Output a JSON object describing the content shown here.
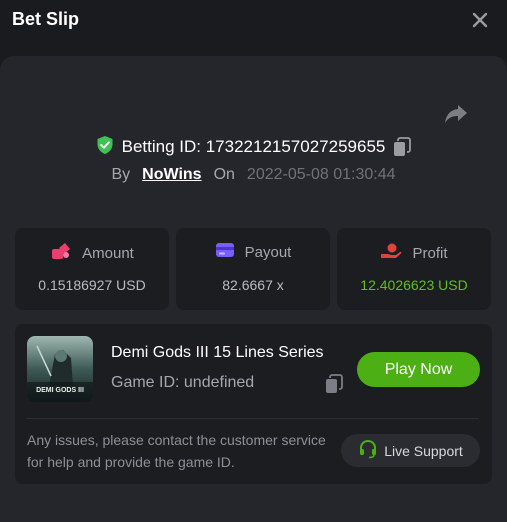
{
  "header": {
    "title": "Bet Slip",
    "close_icon": "close-icon"
  },
  "bet": {
    "betting_id": "Betting ID: 1732212157027259655",
    "by_label": "By",
    "username": "NoWins",
    "on_label": "On",
    "datetime": "2022-05-08 01:30:44"
  },
  "stats": {
    "amount": {
      "label": "Amount",
      "value": "0.15186927 USD",
      "icon": "coins-icon",
      "color": "#e83f6f"
    },
    "payout": {
      "label": "Payout",
      "value": "82.6667 x",
      "icon": "card-icon",
      "color": "#7b5cff"
    },
    "profit": {
      "label": "Profit",
      "value": "12.4026623 USD",
      "icon": "money-hand-icon",
      "color": "#e0433b",
      "value_color": "#5fbf1f"
    }
  },
  "game": {
    "name": "Demi Gods III 15 Lines Series",
    "game_id": "Game ID: undefined",
    "thumb_text": "DEMI GODS III",
    "play_label": "Play Now"
  },
  "support": {
    "text": "Any issues, please contact the customer service for help and provide the game ID.",
    "button_label": "Live Support"
  },
  "colors": {
    "accent_green": "#4caf14",
    "shield_green": "#3ec254"
  }
}
